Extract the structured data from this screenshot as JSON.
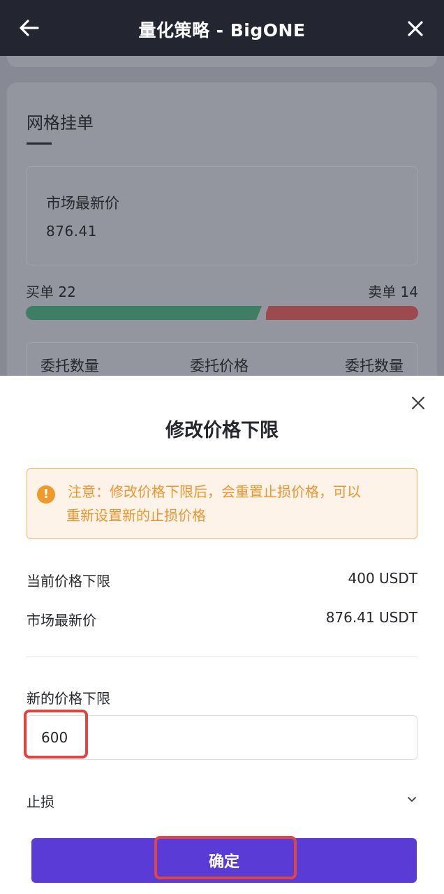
{
  "header": {
    "title": "量化策略 - BigONE",
    "back_icon": "arrow-left-icon",
    "close_icon": "close-icon"
  },
  "background": {
    "tab_title": "网格挂单",
    "market_price_label": "市场最新价",
    "market_price_value": "876.41",
    "buy_label": "买单 22",
    "sell_label": "卖单 14",
    "buy_ratio": 0.61,
    "table_headers": [
      "委托数量",
      "委托价格",
      "委托数量"
    ]
  },
  "modal": {
    "title": "修改价格下限",
    "close_icon": "close-icon",
    "notice": {
      "icon": "warning-icon",
      "line1": "注意：修改价格下限后，会重置止损价格，可以",
      "line2": "重新设置新的止损价格"
    },
    "rows": [
      {
        "label": "当前价格下限",
        "value": "400 USDT"
      },
      {
        "label": "市场最新价",
        "value": "876.41 USDT"
      }
    ],
    "new_price_label": "新的价格下限",
    "new_price_value": "600",
    "stop_loss_label": "止损",
    "stop_loss_icon": "chevron-down-icon",
    "confirm_label": "确定"
  },
  "colors": {
    "header_bg": "#232630",
    "buy": "#3f7d65",
    "sell": "#9b4b50",
    "notice_text": "#ef9430",
    "notice_border": "#f2b56b",
    "primary": "#5a3bd6",
    "highlight": "#e0453f"
  }
}
